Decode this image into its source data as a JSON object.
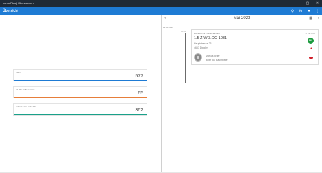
{
  "window": {
    "title": "Immo Plus | Überwachen",
    "controls": [
      "–",
      "▢",
      "✕"
    ]
  },
  "appbar": {
    "title": "Übersicht",
    "icons": [
      "search-icon",
      "refresh-icon",
      "user-icon",
      "more-icon"
    ],
    "color": "#1e7bd4"
  },
  "stats": [
    {
      "label": "Neu",
      "value": "577",
      "color": "#1e7bd4"
    },
    {
      "label": "In Bearbeitung",
      "value": "65",
      "color": "#e67e3a"
    },
    {
      "label": "Abgeschlossen",
      "value": "362",
      "color": "#1aa18a"
    }
  ],
  "calendar": {
    "month": "Mai 2023",
    "date_header": "11.05.2023",
    "time_label": "08:00"
  },
  "appointment": {
    "category": "Komplett Auswertung",
    "date": "11.05.2023",
    "title": "1.5 Z-W  3.OG  1031",
    "address_line1": "Hauptstrasse 23",
    "address_line2": "4657 Dieglen",
    "badge": "MH",
    "badge_color": "#1c9a3e",
    "person_name": "Markus Beier",
    "person_company": "Beier AG Baumeister"
  }
}
